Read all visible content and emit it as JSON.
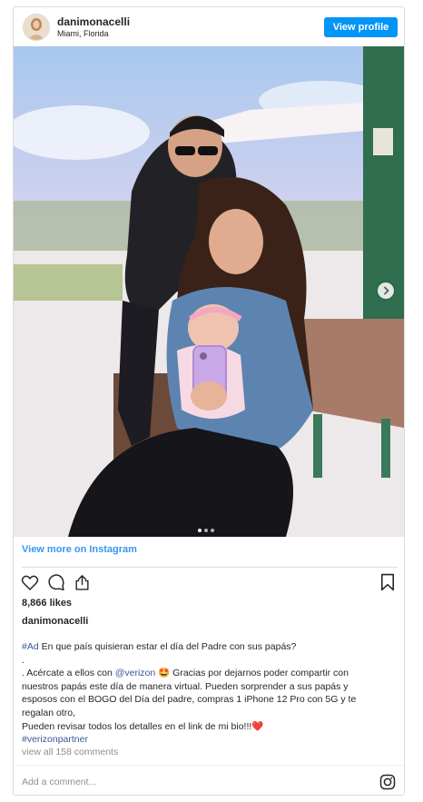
{
  "post": {
    "username": "danimonacelli",
    "location": "Miami, Florida",
    "view_profile_label": "View profile",
    "view_more_label": "View more on Instagram",
    "likes": "8,866 likes",
    "caption_username": "danimonacelli",
    "caption": {
      "hashtag_ad": "#Ad",
      "line1_rest": " En que país quisieran estar el día del Padre con sus papás?",
      "line2": ".",
      "line3_start": ". Acércate a ellos con ",
      "mention": "@verizon",
      "line3_end": " 🤩 Gracias por dejarnos poder compartir con",
      "line4": "nuestros papás este día de manera virtual. Pueden sorprender a sus papás y",
      "line5": "esposos con el BOGO del Día del padre, compras 1 iPhone 12 Pro con 5G y te",
      "line6": "regalan otro,",
      "line7": "Pueden revisar todos los detalles en el link de mi bio!!!❤️",
      "hashtag_partner": "#verizonpartner"
    },
    "view_comments_label": "view all 158 comments",
    "add_comment_placeholder": "Add a comment..."
  },
  "carousel": {
    "current": 1,
    "total": 3
  },
  "icons": [
    "heart-icon",
    "comment-icon",
    "share-icon",
    "bookmark-icon",
    "instagram-icon",
    "chevron-right-icon"
  ],
  "colors": {
    "accent": "#0095f6",
    "link": "#385898",
    "muted": "#8e8e8e"
  }
}
